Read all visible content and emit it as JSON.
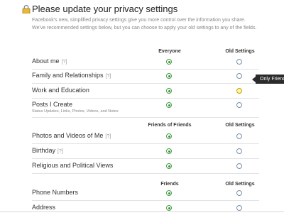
{
  "page": {
    "title": "Please update your privacy settings",
    "description": "Facebook's new, simplified privacy settings give you more control over the information you share. We've recommended settings below, but you can choose to apply your old settings to any of the fields."
  },
  "icons": {
    "title_icon": "lock-icon"
  },
  "sections": [
    {
      "column_new": "Everyone",
      "column_old": "Old Settings",
      "rows": [
        {
          "label": "About me",
          "help": "[?]",
          "sub": "",
          "selected": "new"
        },
        {
          "label": "Family and Relationships",
          "help": "[?]",
          "sub": "",
          "selected": "new"
        },
        {
          "label": "Work and Education",
          "help": "",
          "sub": "",
          "selected": "new"
        },
        {
          "label": "Posts I Create",
          "help": "",
          "sub": "Status Updates, Links, Photos, Videos, and Notes",
          "selected": "new"
        }
      ]
    },
    {
      "column_new": "Friends of Friends",
      "column_old": "Old Settings",
      "rows": [
        {
          "label": "Photos and Videos of Me",
          "help": "[?]",
          "sub": "",
          "selected": "new"
        },
        {
          "label": "Birthday",
          "help": "[?]",
          "sub": "",
          "selected": "new"
        },
        {
          "label": "Religious and Political Views",
          "help": "",
          "sub": "",
          "selected": "new"
        }
      ]
    },
    {
      "column_new": "Friends",
      "column_old": "Old Settings",
      "rows": [
        {
          "label": "Phone Numbers",
          "help": "",
          "sub": "",
          "selected": "new"
        },
        {
          "label": "Address",
          "help": "",
          "sub": "",
          "selected": "new"
        }
      ]
    }
  ],
  "tooltip": {
    "text": "Only Friends"
  },
  "colors": {
    "radio_selected": "#2e9a2e",
    "tooltip_bg": "#2b2b2b"
  }
}
